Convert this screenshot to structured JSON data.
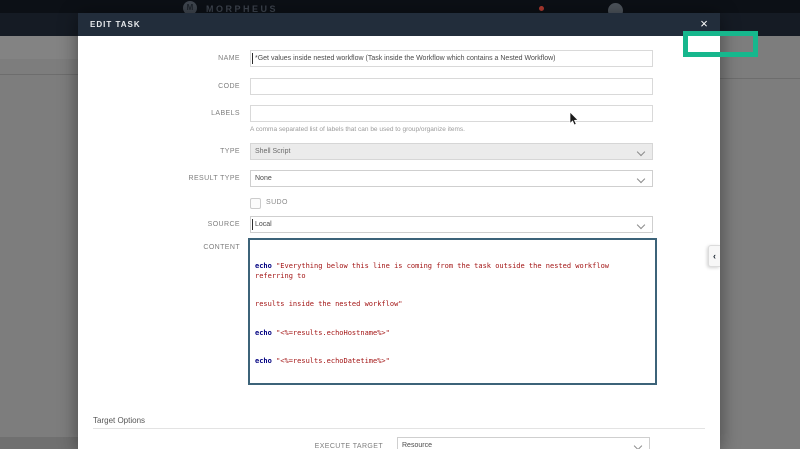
{
  "background": {
    "brand": "MORPHEUS",
    "logo_letter": "M"
  },
  "modal": {
    "title": "EDIT TASK",
    "close_icon": "×"
  },
  "form": {
    "name": {
      "label": "NAME",
      "value": "*Get values inside nested workflow (Task inside the Workflow which contains a Nested Workflow)"
    },
    "code": {
      "label": "CODE",
      "value": ""
    },
    "labels": {
      "label": "LABELS",
      "value": "",
      "help": "A comma separated list of labels that can be used to group/organize items."
    },
    "type": {
      "label": "TYPE",
      "value": "Shell Script"
    },
    "result_type": {
      "label": "RESULT TYPE",
      "value": "None"
    },
    "sudo": {
      "label": "SUDO",
      "checked": false
    },
    "source": {
      "label": "SOURCE",
      "value": "Local"
    },
    "content": {
      "label": "CONTENT",
      "lines": [
        {
          "kw": "echo",
          "str": " \"Everything below this line is coming from the task outside the nested workflow referring to"
        },
        {
          "kw": "",
          "str": "results inside the nested workflow\""
        },
        {
          "kw": "echo",
          "str": " \"<%=results.echoHostname%>\""
        },
        {
          "kw": "echo",
          "str": " \"<%=results.echoDatetime%>\""
        }
      ]
    }
  },
  "target_options": {
    "heading": "Target Options",
    "execute_target": {
      "label": "EXECUTE TARGET",
      "value": "Resource"
    }
  },
  "panel_toggle": {
    "icon": "‹"
  },
  "colors": {
    "annotation_accent": "#16b78d",
    "modal_header": "#222d3b",
    "code_keyword": "#000080",
    "code_string": "#a31515",
    "notification_badge": "#b03a30"
  }
}
